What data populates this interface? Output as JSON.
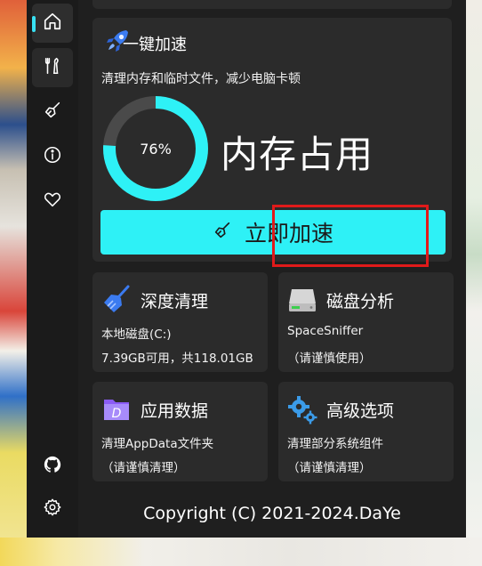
{
  "sidebar": {
    "items": [
      {
        "icon": "home-icon"
      },
      {
        "icon": "tools-icon"
      },
      {
        "icon": "broom-icon"
      },
      {
        "icon": "info-icon"
      },
      {
        "icon": "heart-icon"
      }
    ],
    "bottom": [
      {
        "icon": "github-icon"
      },
      {
        "icon": "gear-icon"
      }
    ]
  },
  "boost": {
    "title": "一键加速",
    "subtitle": "清理内存和临时文件，减少电脑卡顿",
    "memory_percent_label": "76%",
    "memory_fraction": 0.76,
    "memory_label": "内存占用",
    "button_label": "立即加速"
  },
  "tiles": [
    {
      "title": "深度清理",
      "line1": "本地磁盘(C:)",
      "line2": "7.39GB可用，共118.01GB",
      "icon": "broom-color-icon"
    },
    {
      "title": "磁盘分析",
      "line1": "SpaceSniffer",
      "line2": "（请谨慎使用）",
      "icon": "hard-drive-icon"
    },
    {
      "title": "应用数据",
      "line1": "清理AppData文件夹",
      "line2": "（请谨慎清理）",
      "icon": "folder-d-icon"
    },
    {
      "title": "高级选项",
      "line1": "清理部分系统组件",
      "line2": "（请谨慎清理）",
      "icon": "gears-icon"
    }
  ],
  "footer": {
    "copyright": "Copyright (C) 2021-2024.DaYe"
  },
  "colors": {
    "accent": "#2ef1f6",
    "ring_track": "#4a4a4a",
    "highlight_box": "#e01a1a"
  }
}
